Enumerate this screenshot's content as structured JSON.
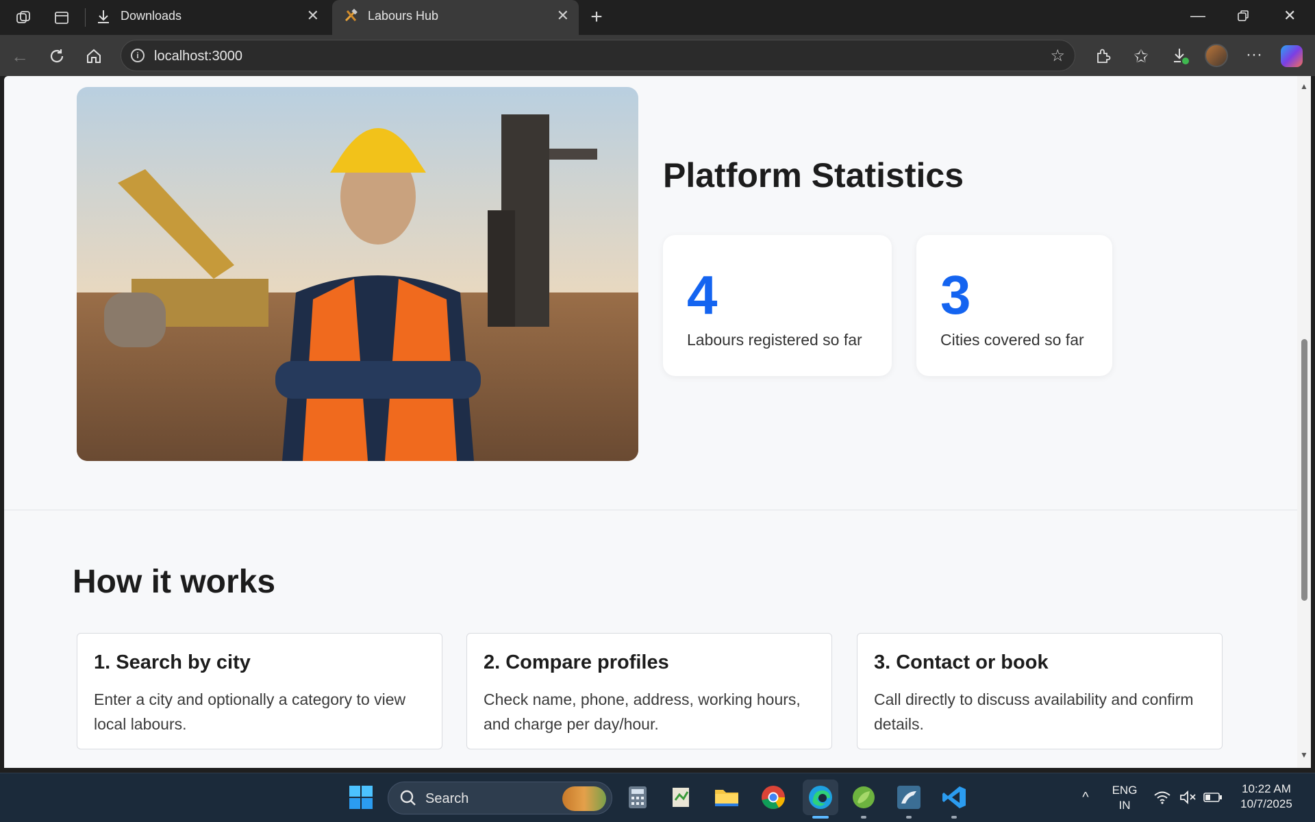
{
  "browser": {
    "tabs": [
      {
        "title": "Downloads",
        "icon": "download-icon"
      },
      {
        "title": "Labours Hub",
        "icon": "tools-icon"
      }
    ],
    "url": "localhost:3000"
  },
  "page": {
    "hero_image": "construction-worker-photo",
    "stats": {
      "title": "Platform Statistics",
      "cards": [
        {
          "number": "4",
          "label": "Labours registered so far"
        },
        {
          "number": "3",
          "label": "Cities covered so far"
        }
      ]
    },
    "how_it_works": {
      "title": "How it works",
      "steps": [
        {
          "title": "1. Search by city",
          "text": "Enter a city and optionally a category to view local labours."
        },
        {
          "title": "2. Compare profiles",
          "text": "Check name, phone, address, working hours, and charge per day/hour."
        },
        {
          "title": "3. Contact or book",
          "text": "Call directly to discuss availability and confirm details."
        }
      ]
    },
    "colors": {
      "accent": "#1464f0",
      "background": "#f7f8fa"
    }
  },
  "taskbar": {
    "search_placeholder": "Search",
    "language": "ENG",
    "region": "IN",
    "time": "10:22 AM",
    "date": "10/7/2025"
  }
}
